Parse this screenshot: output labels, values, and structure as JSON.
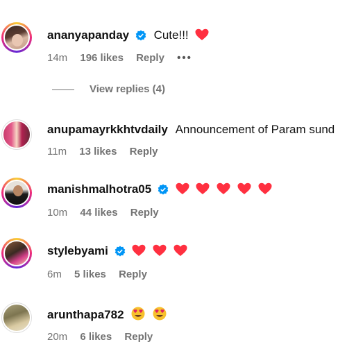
{
  "comments": [
    {
      "username": "ananyapanday",
      "verified": true,
      "text": "Cute!!!",
      "hearts": 1,
      "time": "14m",
      "likes": "196 likes",
      "reply": "Reply",
      "more": "•••",
      "avatar_ring": true
    },
    {
      "username": "anupamayrkkhtvdaily",
      "verified": false,
      "text": "Announcement of Param sund",
      "hearts": 0,
      "time": "11m",
      "likes": "13 likes",
      "reply": "Reply",
      "avatar_ring": false
    },
    {
      "username": "manishmalhotra05",
      "verified": true,
      "text": "",
      "hearts": 5,
      "time": "10m",
      "likes": "44 likes",
      "reply": "Reply",
      "avatar_ring": true
    },
    {
      "username": "stylebyami",
      "verified": true,
      "text": "",
      "hearts": 3,
      "time": "6m",
      "likes": "5 likes",
      "reply": "Reply",
      "avatar_ring": true
    },
    {
      "username": "arunthapa782",
      "verified": false,
      "text": "",
      "hearts": 0,
      "emojis": 2,
      "time": "20m",
      "likes": "6 likes",
      "reply": "Reply",
      "avatar_ring": false
    }
  ],
  "view_replies": "View replies (4)",
  "colors": {
    "heart": "#ff3040",
    "verified": "#0095f6",
    "meta": "#737373"
  },
  "icons": {
    "verified": "verified-badge-icon",
    "heart": "red-heart-icon",
    "emoji": "smiling-face-with-heart-eyes-emoji",
    "more": "more-options-icon"
  }
}
